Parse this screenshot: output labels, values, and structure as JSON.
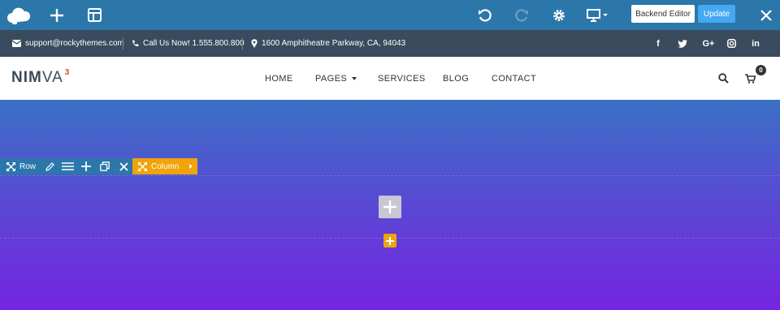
{
  "editor": {
    "backend_editor_label": "Backend Editor",
    "update_label": "Update",
    "icons": [
      "logo-cloud-icon",
      "add-icon",
      "templates-icon",
      "undo-icon",
      "redo-icon",
      "settings-icon",
      "preview-icon",
      "close-icon"
    ]
  },
  "info_bar": {
    "email": "support@rockythemes.com",
    "phone": "Call Us Now! 1.555.800.800",
    "address": "1600 Amphitheatre Parkway, CA, 94043",
    "social": {
      "facebook": "f",
      "google": "G+",
      "linkedin": "in"
    }
  },
  "logo": {
    "bold": "NIM",
    "light": "VA",
    "sup": "3"
  },
  "nav": {
    "home": "HOME",
    "pages": "PAGES",
    "services": "SERVICES",
    "blog": "BLOG",
    "contact": "CONTACT",
    "cart_count": "0"
  },
  "builder": {
    "row_label": "Row",
    "column_label": "Column"
  },
  "colors": {
    "editor_bar": "#2b77aa",
    "info_bar": "#394b5c",
    "update_button": "#45a8f0",
    "column_accent": "#f0a30a",
    "hero_top": "#3a70c6",
    "hero_bottom": "#7524e0"
  }
}
